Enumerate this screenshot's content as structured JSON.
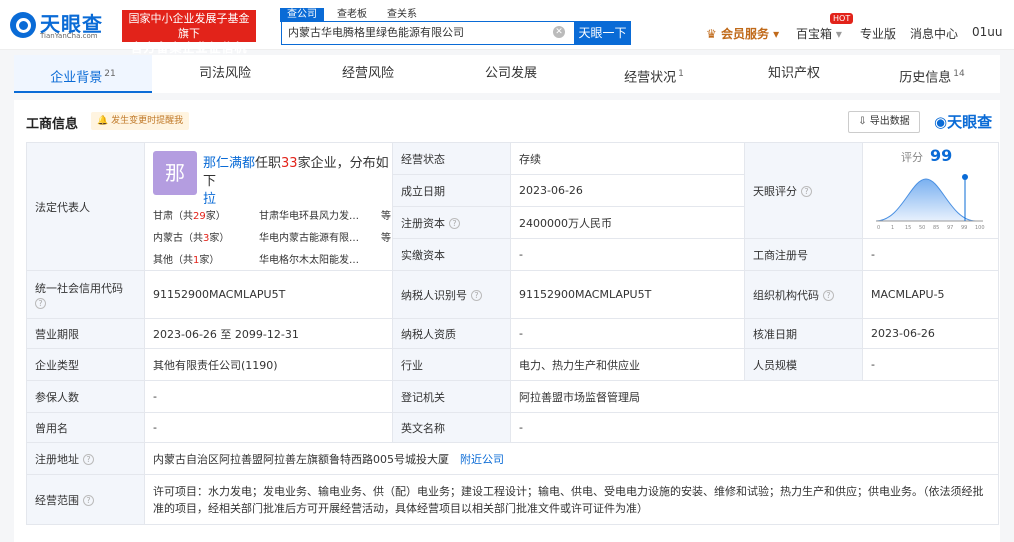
{
  "header": {
    "logo_name": "天眼查",
    "logo_url": "TianYanCha.com",
    "gov_line1": "国家中小企业发展子基金旗下",
    "gov_line2": "官方备案企业征信机构",
    "search_tabs": [
      "查公司",
      "查老板",
      "查关系"
    ],
    "search_value": "内蒙古华电腾格里绿色能源有限公司",
    "search_button": "天眼一下",
    "nav": {
      "vip": "会员服务",
      "baobao": "百宝箱",
      "hot": "HOT",
      "pro": "专业版",
      "msg": "消息中心",
      "user": "01uu"
    }
  },
  "tabs": [
    {
      "label": "企业背景",
      "count": "21"
    },
    {
      "label": "司法风险",
      "count": ""
    },
    {
      "label": "经营风险",
      "count": ""
    },
    {
      "label": "公司发展",
      "count": ""
    },
    {
      "label": "经营状况",
      "count": "1"
    },
    {
      "label": "知识产权",
      "count": ""
    },
    {
      "label": "历史信息",
      "count": "14"
    }
  ],
  "panel": {
    "title": "工商信息",
    "notice": "发生变更时提醒我",
    "export": "导出数据",
    "brand": "天眼查"
  },
  "legal": {
    "label": "法定代表人",
    "avatar": "那",
    "name": "那仁满都",
    "text1": "任职",
    "count": "33",
    "text2": "家企业，分布如下",
    "link_tail": "拉",
    "regions": [
      {
        "prov": "甘肃",
        "num": "29",
        "co": "甘肃华电环县风力发…",
        "more": "等"
      },
      {
        "prov": "内蒙古",
        "num": "3",
        "co": "华电内蒙古能源有限…",
        "more": "等"
      },
      {
        "prov": "其他",
        "num": "1",
        "co": "华电格尔木太阳能发…",
        "more": ""
      }
    ]
  },
  "rows": {
    "status_l": "经营状态",
    "status_v": "存续",
    "found_l": "成立日期",
    "found_v": "2023-06-26",
    "cap_l": "注册资本",
    "cap_v": "2400000万人民币",
    "paid_l": "实缴资本",
    "paid_v": "-",
    "score_l": "天眼评分",
    "score_t": "评分",
    "score_v": "99",
    "reg_l": "工商注册号",
    "reg_v": "-",
    "credit_l": "统一社会信用代码",
    "credit_v": "91152900MACMLAPU5T",
    "tax_l": "纳税人识别号",
    "tax_v": "91152900MACMLAPU5T",
    "org_l": "组织机构代码",
    "org_v": "MACMLAPU-5",
    "term_l": "营业期限",
    "term_v": "2023-06-26 至 2099-12-31",
    "taxq_l": "纳税人资质",
    "taxq_v": "-",
    "appr_l": "核准日期",
    "appr_v": "2023-06-26",
    "type_l": "企业类型",
    "type_v": "其他有限责任公司(1190)",
    "ind_l": "行业",
    "ind_v": "电力、热力生产和供应业",
    "staff_l": "人员规模",
    "staff_v": "-",
    "ins_l": "参保人数",
    "ins_v": "-",
    "auth_l": "登记机关",
    "auth_v": "阿拉善盟市场监督管理局",
    "old_l": "曾用名",
    "old_v": "-",
    "en_l": "英文名称",
    "en_v": "-",
    "addr_l": "注册地址",
    "addr_v": "内蒙古自治区阿拉善盟阿拉善左旗额鲁特西路005号城投大厦",
    "addr_link": "附近公司",
    "scope_l": "经营范围",
    "scope_v": "许可项目：水力发电；发电业务、输电业务、供（配）电业务；建设工程设计；输电、供电、受电电力设施的安装、维修和试验；热力生产和供应；供电业务。（依法须经批准的项目，经相关部门批准后方可开展经营活动，具体经营项目以相关部门批准文件或许可证件为准）"
  },
  "chart_data": {
    "type": "area",
    "x_ticks": [
      "0",
      "1",
      "15",
      "50",
      "85",
      "97",
      "99",
      "100"
    ],
    "marker": "99"
  }
}
